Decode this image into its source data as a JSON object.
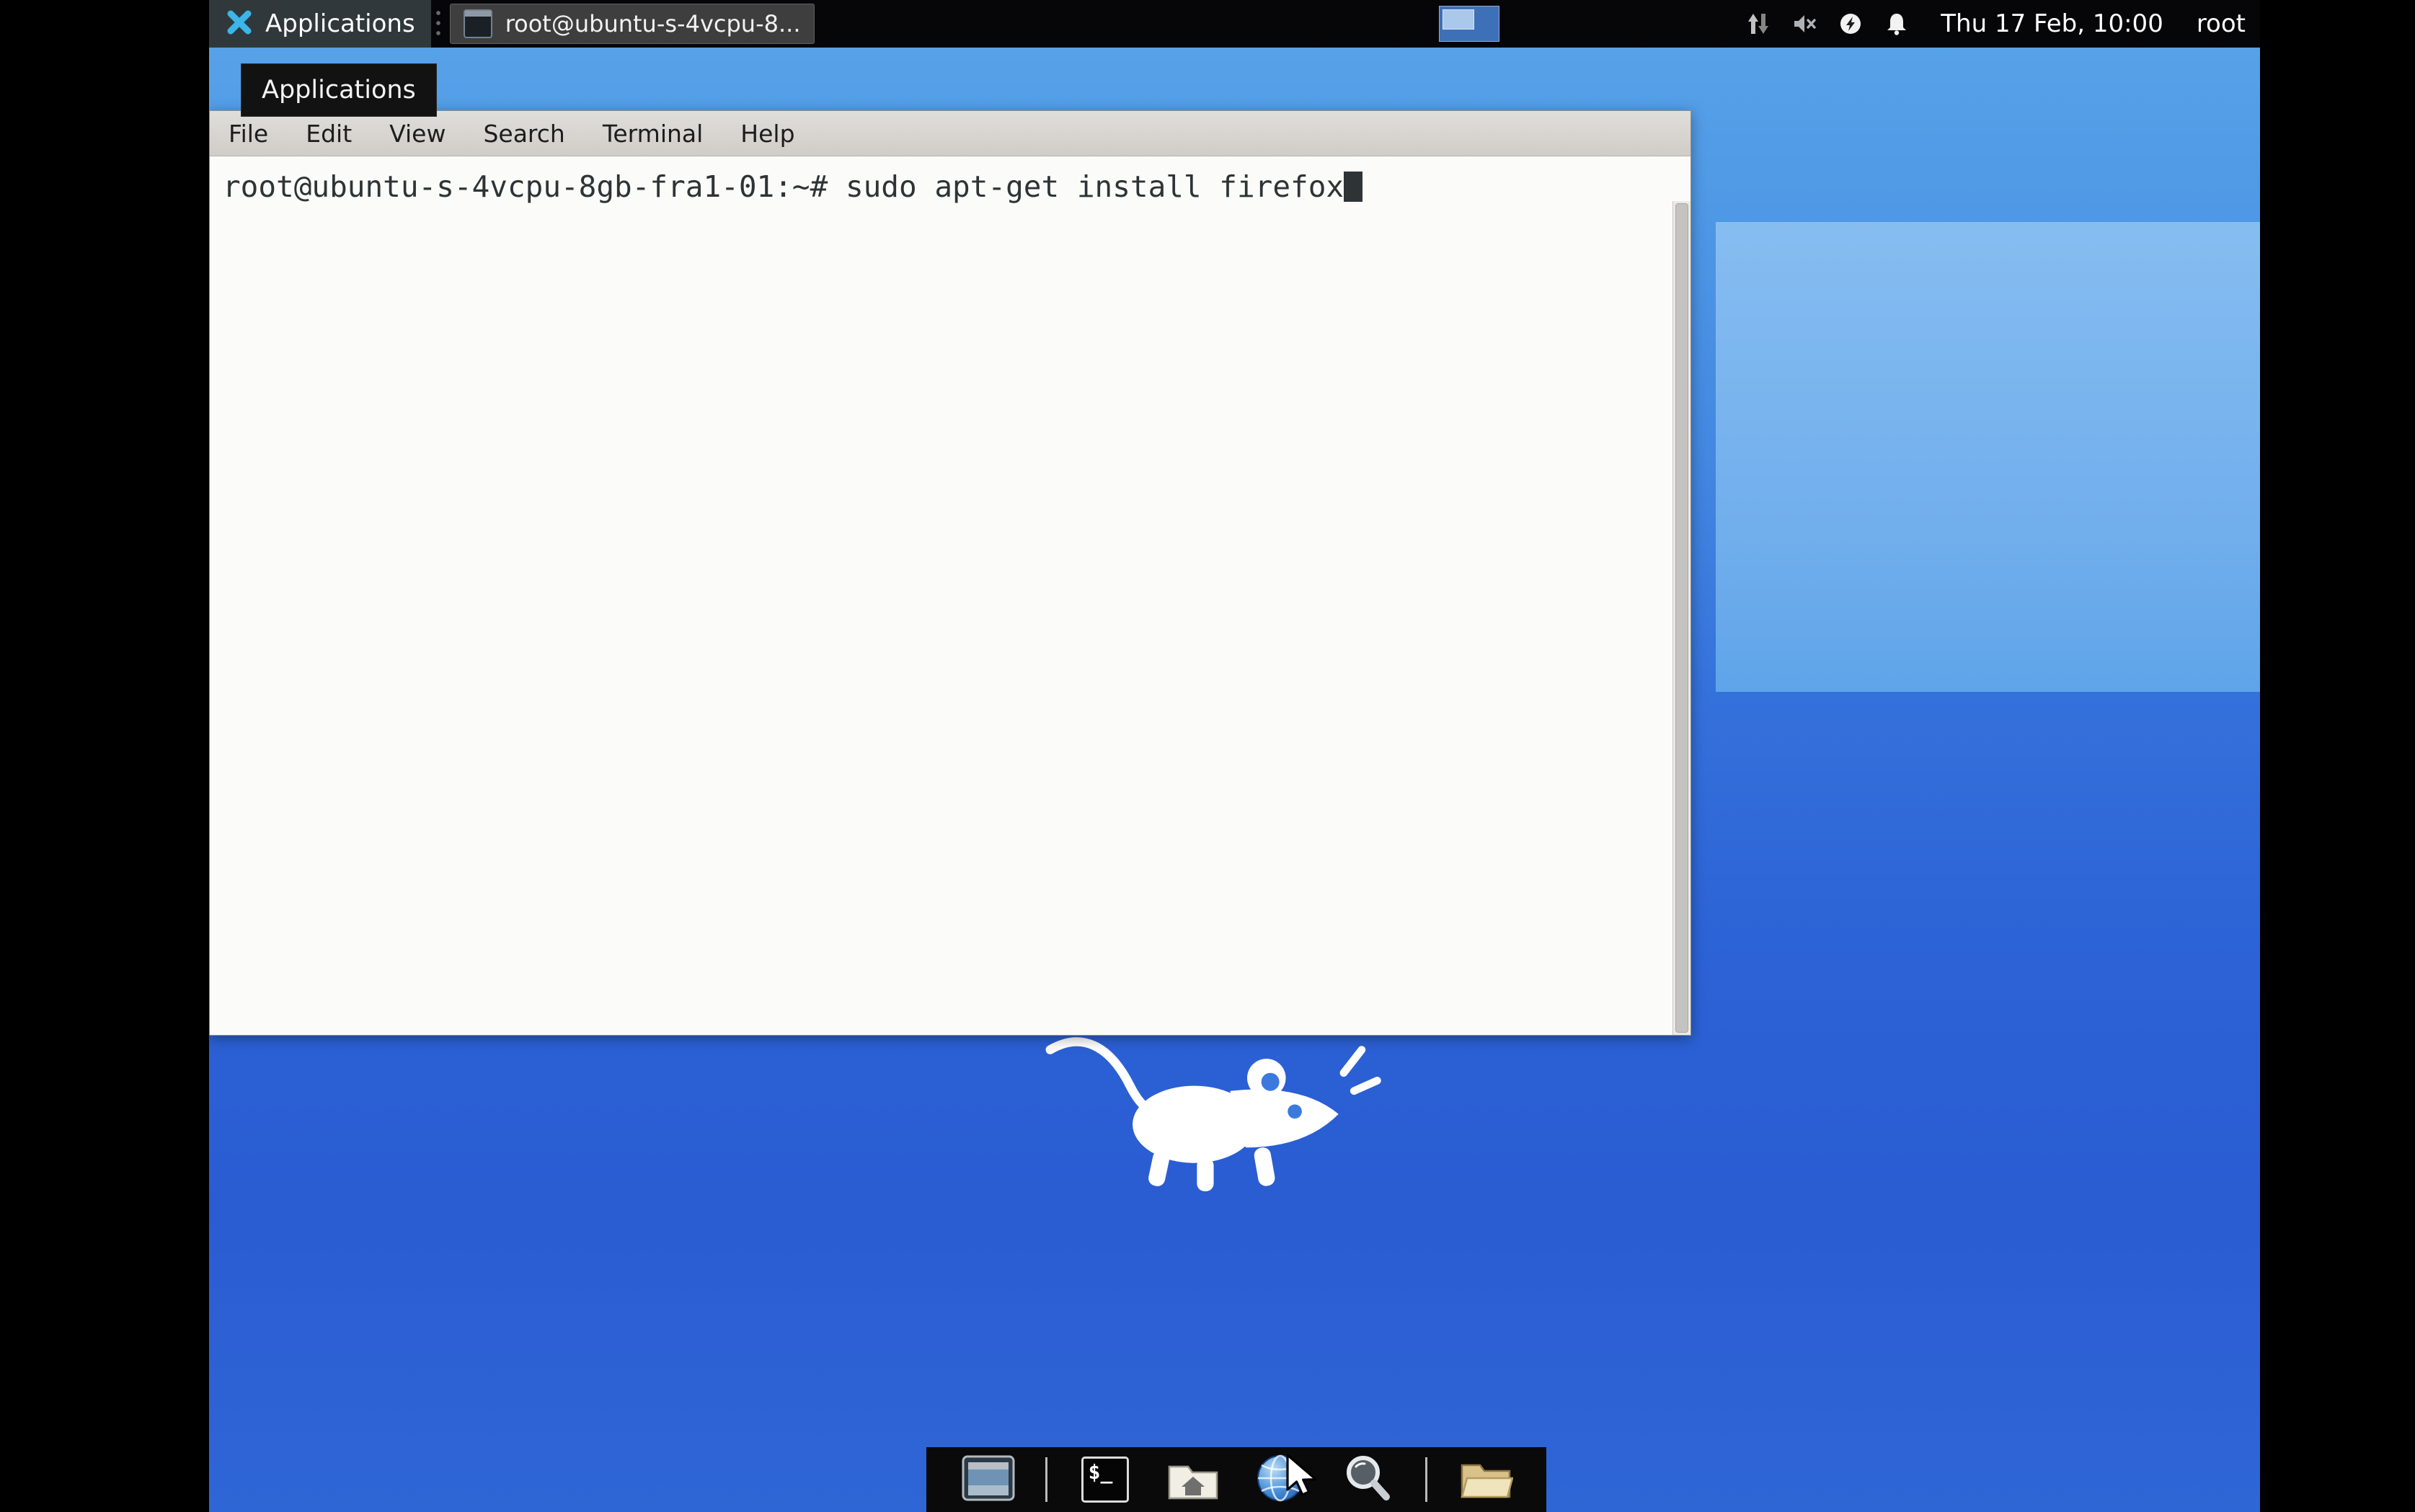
{
  "colors": {
    "panel_bg": "#060608",
    "wallpaper_top": "#5aa4e9",
    "wallpaper_bottom": "#2f66d6",
    "wallpaper_highlight": "#86bdf1",
    "terminal_bg": "#fbfbf9",
    "terminal_fg": "#2e3436",
    "menubar_bg": "#d6d3cf",
    "applications_x_accent": "#3ab6e8"
  },
  "panel": {
    "applications": {
      "label": "Applications",
      "icon": "xfce-x-icon"
    },
    "task_button": {
      "label": "root@ubuntu-s-4vcpu-8...",
      "icon": "terminal-window-icon"
    },
    "pager": {
      "workspaces": 1
    },
    "tray": [
      {
        "name": "network-icon"
      },
      {
        "name": "volume-muted-icon"
      },
      {
        "name": "power-manager-icon"
      },
      {
        "name": "bell-icon"
      }
    ],
    "clock": "Thu 17 Feb, 10:00",
    "user": "root"
  },
  "tooltip": {
    "text": "Applications"
  },
  "terminal_window": {
    "menu_items": [
      "File",
      "Edit",
      "View",
      "Search",
      "Terminal",
      "Help"
    ],
    "prompt": "root@ubuntu-s-4vcpu-8gb-fra1-01:~#",
    "command": "sudo apt-get install firefox",
    "cursor": "block"
  },
  "dock": {
    "items": [
      {
        "name": "desktop-display",
        "icon": "display-icon"
      },
      {
        "name": "terminal-emulator",
        "icon": "xterm-icon",
        "glyph": "$_"
      },
      {
        "name": "home-folder",
        "icon": "home-folder-icon"
      },
      {
        "name": "web-browser",
        "icon": "globe-icon"
      },
      {
        "name": "application-finder",
        "icon": "magnifier-icon"
      },
      {
        "name": "file-manager",
        "icon": "folder-icon"
      }
    ]
  }
}
